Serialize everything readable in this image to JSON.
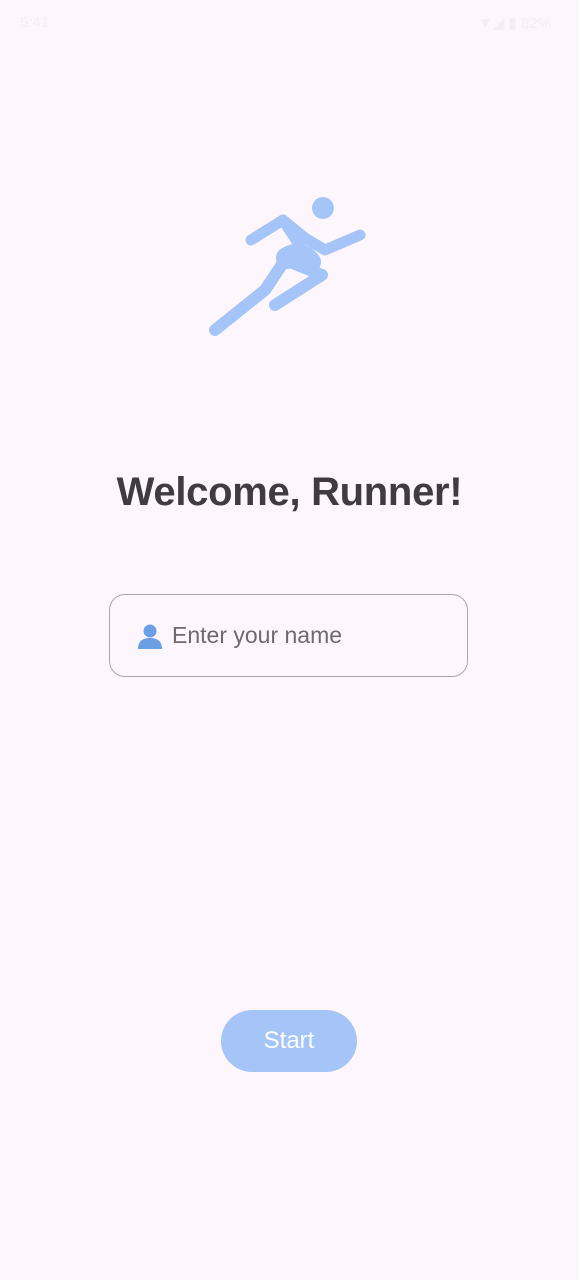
{
  "status_bar": {
    "time": "5:41",
    "right_text": "▼◢ ▮ 82%"
  },
  "icons": {
    "hero": "running-person-icon",
    "field": "person-icon"
  },
  "colors": {
    "background": "#fdf7fd",
    "accent": "#a5c4f7",
    "title": "#3f3b40",
    "field_border": "#aba5ab"
  },
  "main": {
    "title": "Welcome, Runner!",
    "name_field": {
      "placeholder": "Enter your name",
      "value": ""
    },
    "start_label": "Start"
  }
}
